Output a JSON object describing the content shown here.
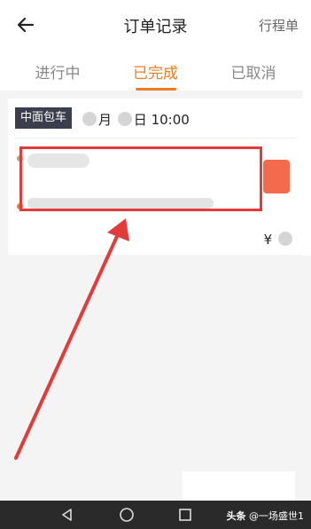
{
  "header": {
    "title": "订单记录",
    "right_action": "行程单"
  },
  "tabs": [
    {
      "label": "进行中",
      "active": false
    },
    {
      "label": "已完成",
      "active": true
    },
    {
      "label": "已取消",
      "active": false
    }
  ],
  "order": {
    "tag": "中面包车",
    "date_month_suffix": "月",
    "date_day_suffix": "日 10:00",
    "price_symbol": "¥"
  },
  "colors": {
    "accent": "#f07c22",
    "highlight": "#e23b3b"
  },
  "watermark": {
    "brand": "头条",
    "handle": "@一场盛世1"
  }
}
